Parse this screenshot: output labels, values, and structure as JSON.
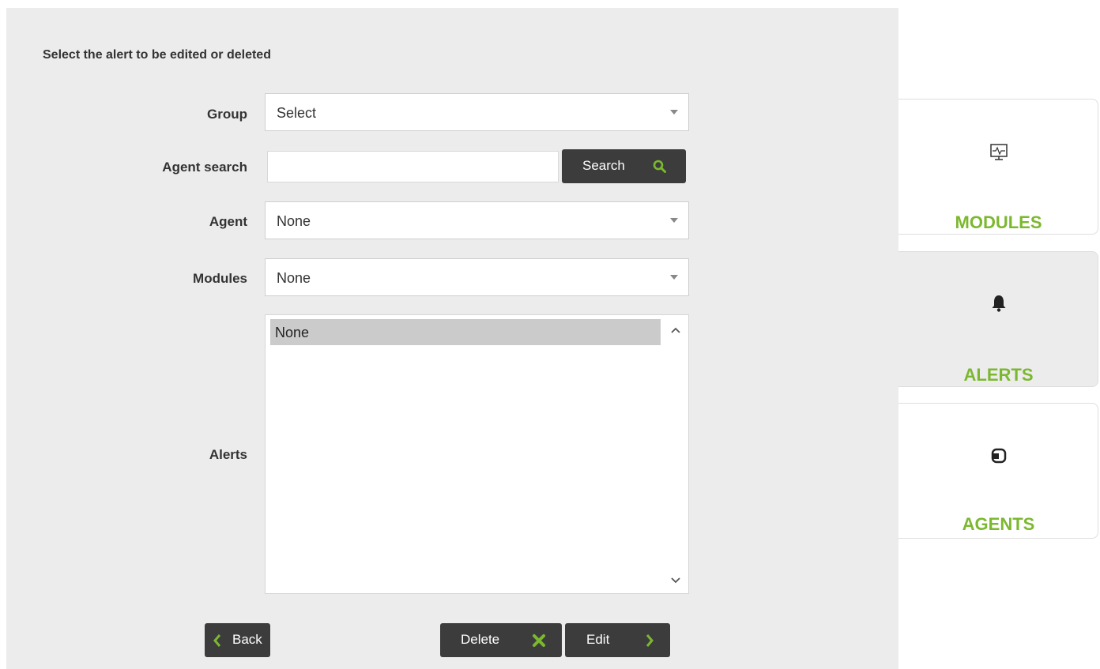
{
  "form": {
    "heading": "Select the alert to be edited or deleted",
    "group": {
      "label": "Group",
      "value": "Select"
    },
    "agent_search": {
      "label": "Agent search",
      "value": "",
      "button_label": "Search"
    },
    "agent": {
      "label": "Agent",
      "value": "None"
    },
    "modules": {
      "label": "Modules",
      "value": "None"
    },
    "alerts": {
      "label": "Alerts",
      "options": [
        "None"
      ],
      "selected": "None"
    }
  },
  "buttons": {
    "back": "Back",
    "delete": "Delete",
    "edit": "Edit"
  },
  "tabs": [
    {
      "label": "MODULES",
      "icon": "monitor-icon",
      "active": false
    },
    {
      "label": "ALERTS",
      "icon": "bell-icon",
      "active": true
    },
    {
      "label": "AGENTS",
      "icon": "agent-icon",
      "active": false
    }
  ],
  "colors": {
    "accent_green": "#7cb82f",
    "button_dark": "#3c3c3c",
    "panel_bg": "#ececec"
  }
}
